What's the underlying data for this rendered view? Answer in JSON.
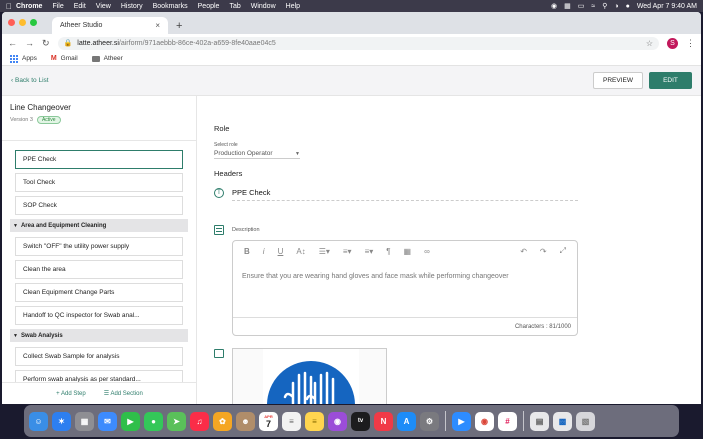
{
  "menubar": {
    "items": [
      "Chrome",
      "File",
      "Edit",
      "View",
      "History",
      "Bookmarks",
      "People",
      "Tab",
      "Window",
      "Help"
    ],
    "datetime": "Wed Apr 7  9:40 AM"
  },
  "browser": {
    "tab_title": "Atheer Studio",
    "url_host": "latte.atheer.si",
    "url_path": "/airform/971aebbb-86ce-402a-a659-8fe40aae04c5",
    "profile_initial": "S",
    "bookmarks": [
      "Apps",
      "Gmail",
      "Atheer"
    ]
  },
  "app": {
    "back_label": "Back to List",
    "preview_label": "PREVIEW",
    "edit_label": "EDIT",
    "accent_color": "#2e7d6b"
  },
  "left_panel": {
    "form_title": "Line Changeover",
    "version": "Version 3",
    "status": "Active",
    "steps": [
      "PPE Check",
      "Tool Check",
      "SOP Check"
    ],
    "sections": [
      {
        "title": "Area and Equipment Cleaning",
        "steps": [
          "Switch \"OFF\" the utility power supply",
          "Clean the area",
          "Clean Equipment Change Parts",
          "Handoff to QC inspector for Swab anal..."
        ]
      },
      {
        "title": "Swab Analysis",
        "steps": [
          "Collect Swab Sample for analysis",
          "Perform swab analysis as per standard..."
        ]
      }
    ],
    "add_step": "Add Step",
    "add_section": "Add Section"
  },
  "main": {
    "role_heading": "Role",
    "select_role_label": "Select role",
    "selected_role": "Production Operator",
    "headers_heading": "Headers",
    "header_value": "PPE Check",
    "description_label": "Description",
    "description_text": "Ensure that you are wearing hand gloves and face mask while performing changeover",
    "char_count": "Characters : 81/1000"
  },
  "dock": {
    "apps": [
      {
        "icon": "finder-icon",
        "color": "#3a8ee6"
      },
      {
        "icon": "safari-icon",
        "color": "#2d7ff0"
      },
      {
        "icon": "launchpad-icon",
        "color": "#8e8e93"
      },
      {
        "icon": "mail-icon",
        "color": "#3d8bfd"
      },
      {
        "icon": "facetime-icon",
        "color": "#2fbf4a"
      },
      {
        "icon": "messages-icon",
        "color": "#34c759"
      },
      {
        "icon": "maps-icon",
        "color": "#5ac05a"
      },
      {
        "icon": "music-icon",
        "color": "#fa2d48"
      },
      {
        "icon": "photos-icon",
        "color": "#f5a623"
      },
      {
        "icon": "contacts-icon",
        "color": "#b08d6a"
      },
      {
        "icon": "calendar-icon",
        "color": "#ffffff"
      },
      {
        "icon": "reminders-icon",
        "color": "#f2f2f2"
      },
      {
        "icon": "notes-icon",
        "color": "#ffd54f"
      },
      {
        "icon": "podcasts-icon",
        "color": "#9b4dd8"
      },
      {
        "icon": "apple-tv-icon",
        "color": "#1c1c1e"
      },
      {
        "icon": "news-icon",
        "color": "#f03a47"
      },
      {
        "icon": "app-store-icon",
        "color": "#1d8cf8"
      },
      {
        "icon": "system-preferences-icon",
        "color": "#7a7a7f"
      },
      {
        "icon": "zoom-icon",
        "color": "#2d8cff"
      },
      {
        "icon": "chrome-icon",
        "color": "#ffffff"
      },
      {
        "icon": "slack-icon",
        "color": "#ffffff"
      },
      {
        "icon": "preview-icon",
        "color": "#e8e8ea"
      },
      {
        "icon": "presentation-icon",
        "color": "#e8e8ea"
      },
      {
        "icon": "trash-icon",
        "color": "#d6d6da"
      }
    ],
    "calendar_month": "APR",
    "calendar_day": "7"
  }
}
